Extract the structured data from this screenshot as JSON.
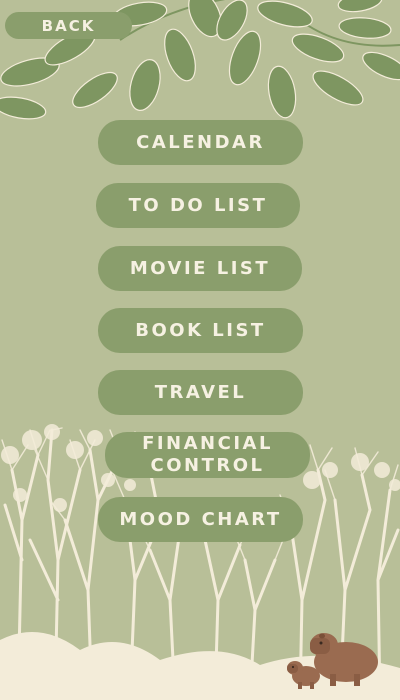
{
  "nav": {
    "back_label": "BACK"
  },
  "menu": {
    "items": [
      {
        "id": "calendar",
        "label": "CALENDAR"
      },
      {
        "id": "todo",
        "label": "TO DO LIST"
      },
      {
        "id": "movie",
        "label": "MOVIE LIST"
      },
      {
        "id": "book",
        "label": "BOOK LIST"
      },
      {
        "id": "travel",
        "label": "TRAVEL"
      },
      {
        "id": "financial",
        "label": "FINANCIAL\nCONTROL"
      },
      {
        "id": "mood",
        "label": "MOOD CHART"
      }
    ]
  },
  "theme": {
    "background": "#b8bf98",
    "button": "#8a9e6c",
    "button_text": "#f6f1e2",
    "leaf": "#7e9661",
    "trees": "#f3ecd9",
    "capybara": "#9a6b50"
  },
  "decor": {
    "top": "leaves-illustration",
    "bottom": "forest-silhouette",
    "corner": "capybara-pair-illustration"
  }
}
